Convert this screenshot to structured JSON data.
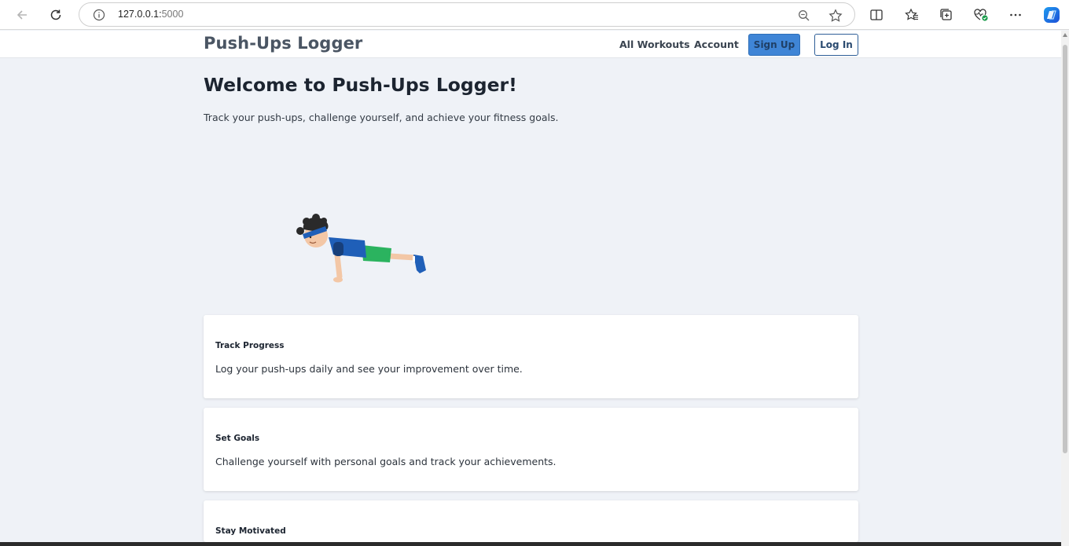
{
  "browser": {
    "url_host": "127.0.0.1:",
    "url_port": "5000",
    "icons": [
      "back-arrow-icon",
      "reload-icon",
      "info-icon",
      "zoom-icon",
      "star-icon",
      "split-screen-icon",
      "favorites-icon",
      "collections-icon",
      "health-icon",
      "more-icon",
      "copilot-icon"
    ]
  },
  "navbar": {
    "brand": "Push-Ups Logger",
    "links": [
      "All Workouts",
      "Account"
    ],
    "signup_label": "Sign Up",
    "login_label": "Log In"
  },
  "hero": {
    "title": "Welcome to Push-Ups Logger!",
    "subtitle": "Track your push-ups, challenge yourself, and achieve your fitness goals."
  },
  "features": [
    {
      "title": "Track Progress",
      "text": "Log your push-ups daily and see your improvement over time."
    },
    {
      "title": "Set Goals",
      "text": "Challenge yourself with personal goals and track your achievements."
    },
    {
      "title": "Stay Motivated",
      "text": ""
    }
  ],
  "colors": {
    "page_bg": "#eff2f7",
    "primary": "#3f85d6",
    "text_dark": "#1c2430"
  }
}
